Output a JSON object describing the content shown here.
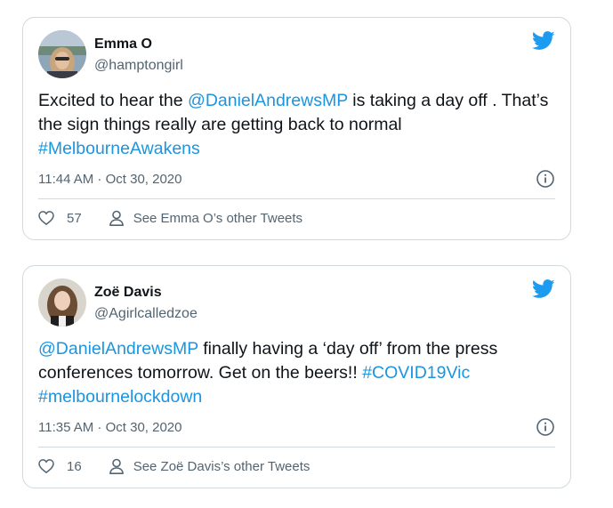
{
  "tweets": [
    {
      "name": "Emma O",
      "handle": "@hamptongirl",
      "text_parts": [
        {
          "text": "Excited to hear the ",
          "link": false
        },
        {
          "text": "@DanielAndrewsMP",
          "link": true
        },
        {
          "text": " is taking a day off . That’s the sign things really are getting back to normal ",
          "link": false
        },
        {
          "text": "#MelbourneAwakens",
          "link": true
        }
      ],
      "timestamp": "11:44 AM · Oct 30, 2020",
      "likes": "57",
      "other_tweets_label": "See Emma O’s other Tweets"
    },
    {
      "name": "Zoë Davis",
      "handle": "@Agirlcalledzoe",
      "text_parts": [
        {
          "text": "@DanielAndrewsMP",
          "link": true
        },
        {
          "text": " finally having a ‘day off’ from the press conferences tomorrow. Get on the beers!! ",
          "link": false
        },
        {
          "text": "#COVID19Vic",
          "link": true
        },
        {
          "text": " ",
          "link": false
        },
        {
          "text": "#melbournelockdown",
          "link": true
        }
      ],
      "timestamp": "11:35 AM · Oct 30, 2020",
      "likes": "16",
      "other_tweets_label": "See Zoë Davis’s other Tweets"
    }
  ],
  "icons": {
    "brand": "twitter-bird-icon",
    "info": "info-icon",
    "like": "heart-icon",
    "profile": "person-icon"
  },
  "colors": {
    "link": "#1b95e0",
    "twitter_blue": "#1d9bf0",
    "secondary_text": "#536471",
    "border": "#cfd9de"
  }
}
